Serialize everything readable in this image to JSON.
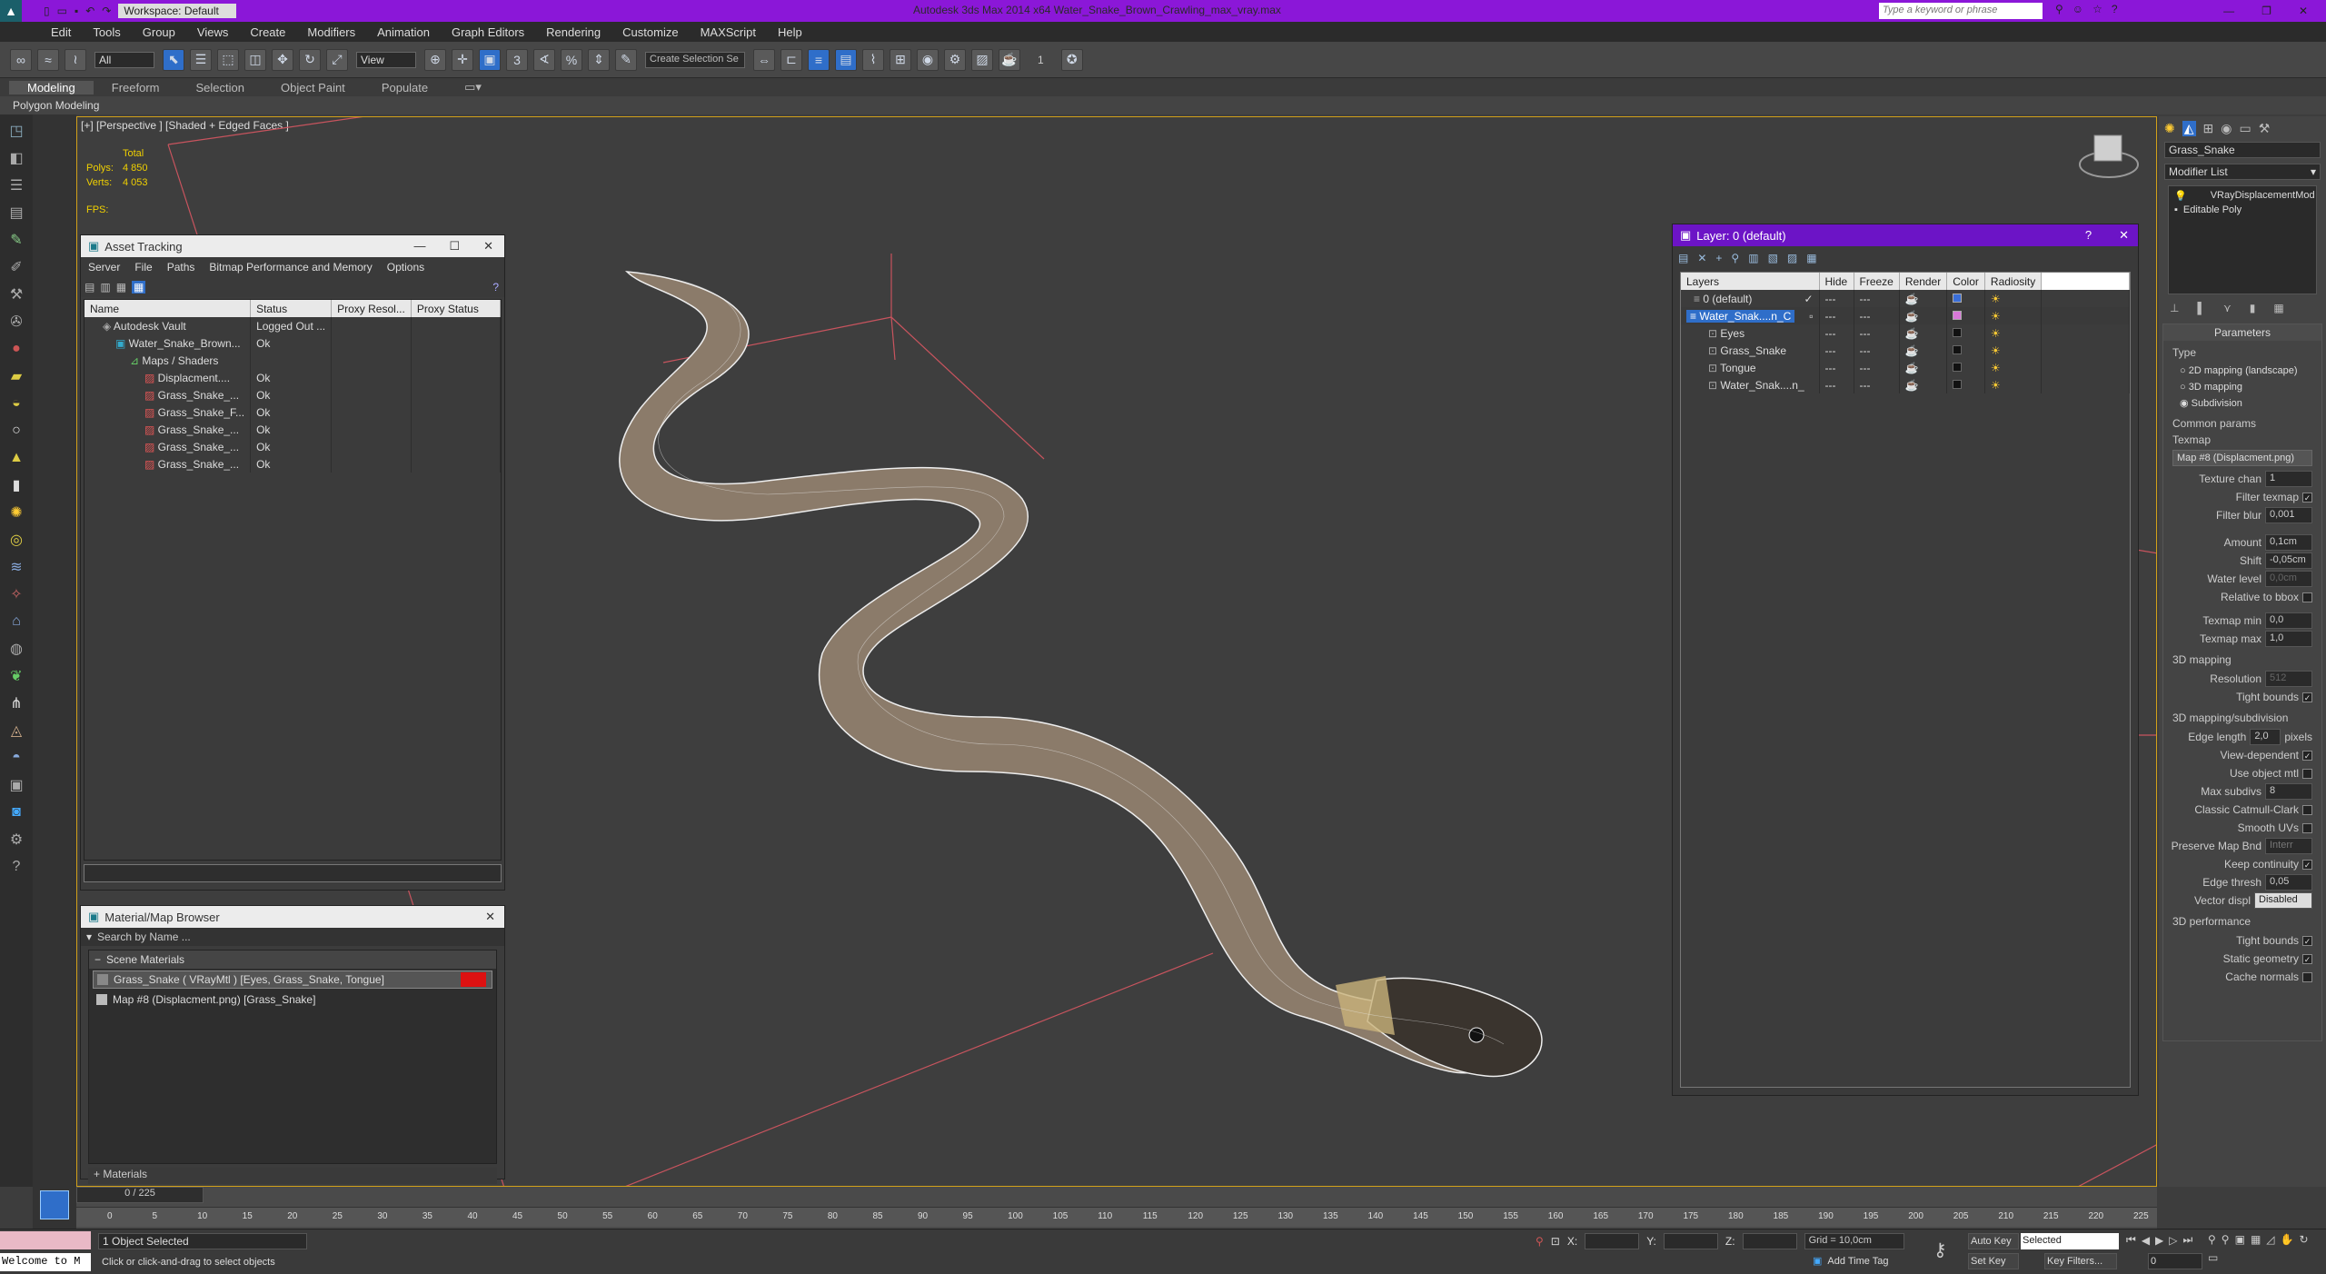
{
  "app": {
    "title": "Autodesk 3ds Max  2014 x64     Water_Snake_Brown_Crawling_max_vray.max",
    "workspace": "Workspace: Default",
    "search_placeholder": "Type a keyword or phrase",
    "accent": "#8b17d8"
  },
  "menu": [
    "Edit",
    "Tools",
    "Group",
    "Views",
    "Create",
    "Modifiers",
    "Animation",
    "Graph Editors",
    "Rendering",
    "Customize",
    "MAXScript",
    "Help"
  ],
  "toolbar": {
    "selection_filter": "All",
    "ref_coord": "View",
    "selection_set": "Create Selection Se",
    "num": "1"
  },
  "ribbon": {
    "tabs": [
      "Modeling",
      "Freeform",
      "Selection",
      "Object Paint",
      "Populate"
    ],
    "sub": "Polygon Modeling"
  },
  "viewport": {
    "label": "[+] [Perspective ] [Shaded + Edged Faces ]",
    "stats": {
      "total": "Total",
      "polys_label": "Polys:",
      "polys": "4 850",
      "verts_label": "Verts:",
      "verts": "4 053",
      "fps": "FPS:"
    }
  },
  "asset_tracking": {
    "title": "Asset Tracking",
    "menu": [
      "Server",
      "File",
      "Paths",
      "Bitmap Performance and Memory",
      "Options"
    ],
    "columns": [
      "Name",
      "Status",
      "Proxy Resol...",
      "Proxy Status"
    ],
    "rows": [
      {
        "name": "Autodesk Vault",
        "status": "Logged Out ..."
      },
      {
        "name": "Water_Snake_Brown...",
        "status": "Ok"
      },
      {
        "name": "Maps / Shaders",
        "status": ""
      },
      {
        "name": "Displacment....",
        "status": "Ok"
      },
      {
        "name": "Grass_Snake_...",
        "status": "Ok"
      },
      {
        "name": "Grass_Snake_F...",
        "status": "Ok"
      },
      {
        "name": "Grass_Snake_...",
        "status": "Ok"
      },
      {
        "name": "Grass_Snake_...",
        "status": "Ok"
      },
      {
        "name": "Grass_Snake_...",
        "status": "Ok"
      }
    ]
  },
  "material_browser": {
    "title": "Material/Map Browser",
    "search": "Search by Name ...",
    "section": "Scene Materials",
    "items": [
      "Grass_Snake  ( VRayMtl ) [Eyes, Grass_Snake, Tongue]",
      "Map #8 (Displacment.png)  [Grass_Snake]"
    ],
    "footer": "+ Materials"
  },
  "layer": {
    "title": "Layer: 0 (default)",
    "columns": [
      "Layers",
      "Hide",
      "Freeze",
      "Render",
      "Color",
      "Radiosity"
    ],
    "rows": [
      {
        "name": "0 (default)",
        "color": "#3a6ed8"
      },
      {
        "name": "Water_Snak....n_C",
        "color": "#d878d8"
      },
      {
        "name": "Eyes",
        "color": "#111111"
      },
      {
        "name": "Grass_Snake",
        "color": "#111111"
      },
      {
        "name": "Tongue",
        "color": "#111111"
      },
      {
        "name": "Water_Snak....n_",
        "color": "#111111"
      }
    ]
  },
  "command": {
    "object_name": "Grass_Snake",
    "modifier_list": "Modifier List",
    "stack": [
      "VRayDisplacementMod",
      "Editable Poly"
    ],
    "rollout": "Parameters",
    "type_label": "Type",
    "types": [
      "2D mapping (landscape)",
      "3D mapping",
      "Subdivision"
    ],
    "common": "Common params",
    "texmap": "Texmap",
    "texmap_value": "Map #8 (Displacment.png)",
    "params": [
      {
        "label": "Texture chan",
        "value": "1"
      },
      {
        "label": "Filter texmap",
        "check": "✓"
      },
      {
        "label": "Filter blur",
        "value": "0,001"
      },
      {
        "label": "Amount",
        "value": "0,1cm"
      },
      {
        "label": "Shift",
        "value": "-0,05cm"
      },
      {
        "label": "Water level",
        "value": "0,0cm"
      },
      {
        "label": "Relative to bbox",
        "check": ""
      },
      {
        "label": "Texmap min",
        "value": "0,0"
      },
      {
        "label": "Texmap max",
        "value": "1,0"
      }
    ],
    "map3d": "3D mapping",
    "resolution": {
      "label": "Resolution",
      "value": "512"
    },
    "tight": "Tight bounds",
    "subdiv": "3D mapping/subdivision",
    "sub_params": [
      {
        "label": "Edge length",
        "value": "2,0",
        "suffix": "pixels"
      },
      {
        "label": "View-dependent",
        "check": "✓"
      },
      {
        "label": "Use object mtl",
        "check": ""
      },
      {
        "label": "Max subdivs",
        "value": "8"
      },
      {
        "label": "Classic Catmull-Clark",
        "check": ""
      },
      {
        "label": "Smooth UVs",
        "check": ""
      },
      {
        "label": "Preserve Map Bnd",
        "value": "Interr"
      },
      {
        "label": "Keep continuity",
        "check": "✓"
      },
      {
        "label": "Edge thresh",
        "value": "0,05"
      },
      {
        "label": "Vector displ",
        "value": "Disabled"
      }
    ],
    "perf": "3D performance",
    "perf_params": [
      {
        "label": "Tight bounds",
        "check": "✓"
      },
      {
        "label": "Static geometry",
        "check": "✓"
      },
      {
        "label": "Cache normals",
        "check": ""
      }
    ]
  },
  "timeline": {
    "frame": "0 / 225",
    "ticks": [
      "0",
      "5",
      "10",
      "15",
      "20",
      "25",
      "30",
      "35",
      "40",
      "45",
      "50",
      "55",
      "60",
      "65",
      "70",
      "75",
      "80",
      "85",
      "90",
      "95",
      "100",
      "105",
      "110",
      "115",
      "120",
      "125",
      "130",
      "135",
      "140",
      "145",
      "150",
      "155",
      "160",
      "165",
      "170",
      "175",
      "180",
      "185",
      "190",
      "195",
      "200",
      "205",
      "210",
      "215",
      "220",
      "225"
    ]
  },
  "status": {
    "script": "Welcome to M",
    "selected": "1 Object Selected",
    "prompt": "Click or click-and-drag to select objects",
    "x": "X:",
    "y": "Y:",
    "z": "Z:",
    "grid": "Grid = 10,0cm",
    "tag": "Add Time Tag",
    "autokey": "Auto Key",
    "selected_dd": "Selected",
    "setkey": "Set Key",
    "keyfilters": "Key Filters...",
    "frame": "0"
  }
}
